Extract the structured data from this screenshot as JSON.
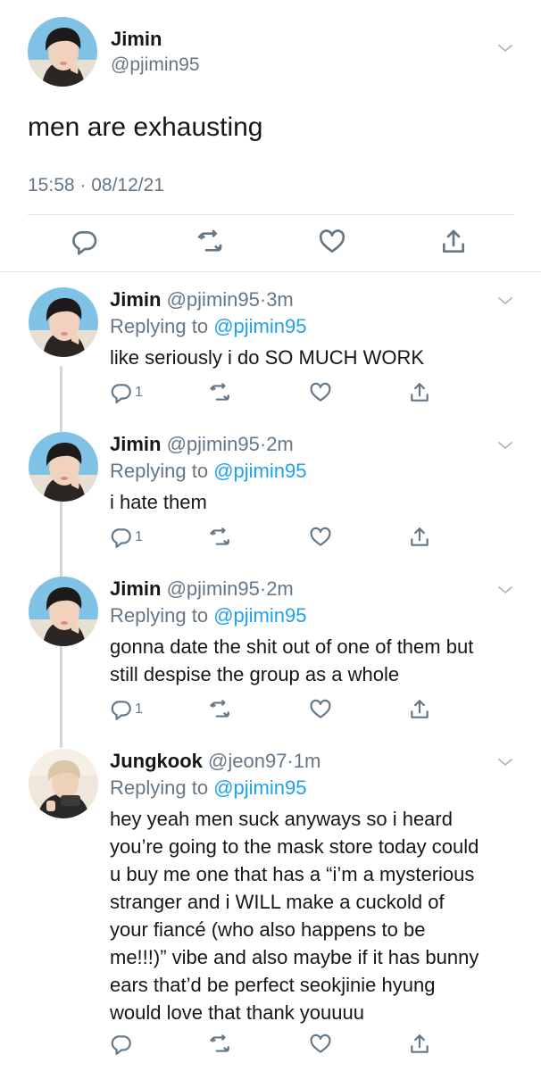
{
  "main_tweet": {
    "name": "Jimin",
    "handle": "@pjimin95",
    "text": "men are exhausting",
    "timestamp": "15:58 · 08/12/21"
  },
  "replies": [
    {
      "name": "Jimin",
      "handle": "@pjimin95",
      "dot": "·",
      "ago": "3m",
      "replying_prefix": "Replying to ",
      "replying_to": "@pjimin95",
      "text": "like seriously i do SO MUCH WORK",
      "reply_count": "1"
    },
    {
      "name": "Jimin",
      "handle": "@pjimin95",
      "dot": "·",
      "ago": "2m",
      "replying_prefix": "Replying to ",
      "replying_to": "@pjimin95",
      "text": "i hate them",
      "reply_count": "1"
    },
    {
      "name": "Jimin",
      "handle": "@pjimin95",
      "dot": "·",
      "ago": "2m",
      "replying_prefix": "Replying to ",
      "replying_to": "@pjimin95",
      "text": "gonna date the shit out of one of them but\nstill despise the group as a whole",
      "reply_count": "1"
    },
    {
      "name": "Jungkook",
      "handle": "@jeon97",
      "dot": "·",
      "ago": "1m",
      "replying_prefix": "Replying to ",
      "replying_to": "@pjimin95",
      "text": "hey yeah men suck anyways so i heard\nyou’re going to the mask store today could\nu buy me one that has a “i’m a mysterious\nstranger and i WILL make a cuckold of\nyour fiancé (who also happens to be\nme!!!)” vibe and also maybe if it has bunny\nears that’d be perfect seokjinie hyung\nwould love that thank youuuu",
      "reply_count": ""
    }
  ],
  "colors": {
    "text": "#14171a",
    "secondary": "#657786",
    "link": "#1da1f2",
    "icon": "#657786",
    "divider": "#e1e5e9",
    "thread_line": "#ccd6dd"
  },
  "icons": {
    "more": "chevron-down-icon",
    "reply": "reply-icon",
    "retweet": "retweet-icon",
    "like": "heart-icon",
    "share": "share-icon"
  }
}
